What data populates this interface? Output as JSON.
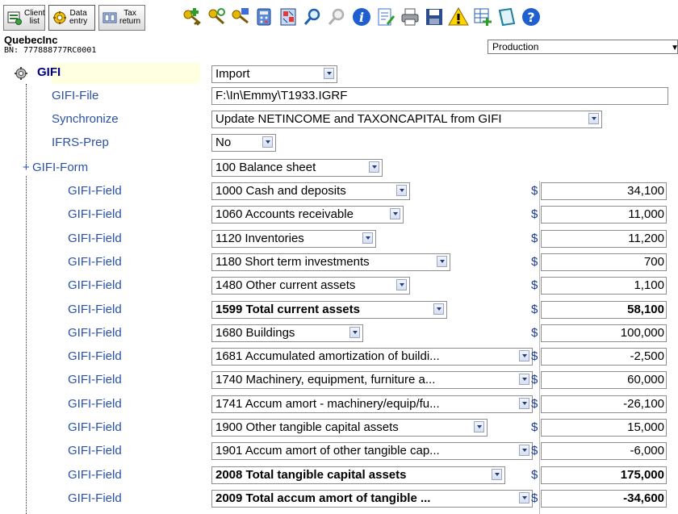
{
  "toolbar": {
    "modes": [
      {
        "label": "Client\nlist",
        "icon": "client-list-icon"
      },
      {
        "label": "Data\nentry",
        "icon": "data-entry-icon"
      },
      {
        "label": "Tax\nreturn",
        "icon": "tax-return-icon"
      }
    ],
    "icons": [
      "key-add-icon",
      "key-search-icon",
      "key-lock-icon",
      "calculator-icon",
      "split-calc-icon",
      "search-icon",
      "search-next-icon",
      "info-icon",
      "notes-icon",
      "print-icon",
      "save-icon",
      "warning-icon",
      "add-table-icon",
      "diagnostics-icon",
      "help-icon"
    ]
  },
  "client": {
    "name": "QuebecInc",
    "bn": "BN: 777888777RC0001"
  },
  "environment": {
    "selected": "Production"
  },
  "tree": {
    "gifi": {
      "label": "GIFI",
      "value": "Import"
    },
    "gifi_file": {
      "label": "GIFI-File",
      "value": "F:\\In\\Emmy\\T1933.IGRF"
    },
    "synchronize": {
      "label": "Synchronize",
      "value": "Update NETINCOME and TAXONCAPITAL from GIFI"
    },
    "ifrs_prep": {
      "label": "IFRS-Prep",
      "value": "No"
    },
    "gifi_form": {
      "expander": "+",
      "label": "GIFI-Form",
      "value": "100  Balance sheet"
    },
    "fields": [
      {
        "label": "GIFI-Field",
        "item": "1000  Cash and deposits",
        "currency": "$",
        "amount": "34,100",
        "bold": false
      },
      {
        "label": "GIFI-Field",
        "item": "1060  Accounts receivable",
        "currency": "$",
        "amount": "11,000",
        "bold": false
      },
      {
        "label": "GIFI-Field",
        "item": "1120  Inventories",
        "currency": "$",
        "amount": "11,200",
        "bold": false
      },
      {
        "label": "GIFI-Field",
        "item": "1180  Short term investments",
        "currency": "$",
        "amount": "700",
        "bold": false
      },
      {
        "label": "GIFI-Field",
        "item": "1480  Other current assets",
        "currency": "$",
        "amount": "1,100",
        "bold": false
      },
      {
        "label": "GIFI-Field",
        "item": "1599  Total current assets",
        "currency": "$",
        "amount": "58,100",
        "bold": true
      },
      {
        "label": "GIFI-Field",
        "item": "1680  Buildings",
        "currency": "$",
        "amount": "100,000",
        "bold": false
      },
      {
        "label": "GIFI-Field",
        "item": "1681  Accumulated amortization of buildi...",
        "currency": "$",
        "amount": "-2,500",
        "bold": false
      },
      {
        "label": "GIFI-Field",
        "item": "1740  Machinery, equipment, furniture a...",
        "currency": "$",
        "amount": "60,000",
        "bold": false
      },
      {
        "label": "GIFI-Field",
        "item": "1741  Accum amort - machinery/equip/fu...",
        "currency": "$",
        "amount": "-26,100",
        "bold": false
      },
      {
        "label": "GIFI-Field",
        "item": "1900  Other tangible capital assets",
        "currency": "$",
        "amount": "15,000",
        "bold": false
      },
      {
        "label": "GIFI-Field",
        "item": "1901  Accum amort of other tangible cap...",
        "currency": "$",
        "amount": "-6,000",
        "bold": false
      },
      {
        "label": "GIFI-Field",
        "item": "2008  Total tangible capital assets",
        "currency": "$",
        "amount": "175,000",
        "bold": true
      },
      {
        "label": "GIFI-Field",
        "item": "2009  Total accum amort of tangible ...",
        "currency": "$",
        "amount": "-34,600",
        "bold": true
      }
    ]
  }
}
